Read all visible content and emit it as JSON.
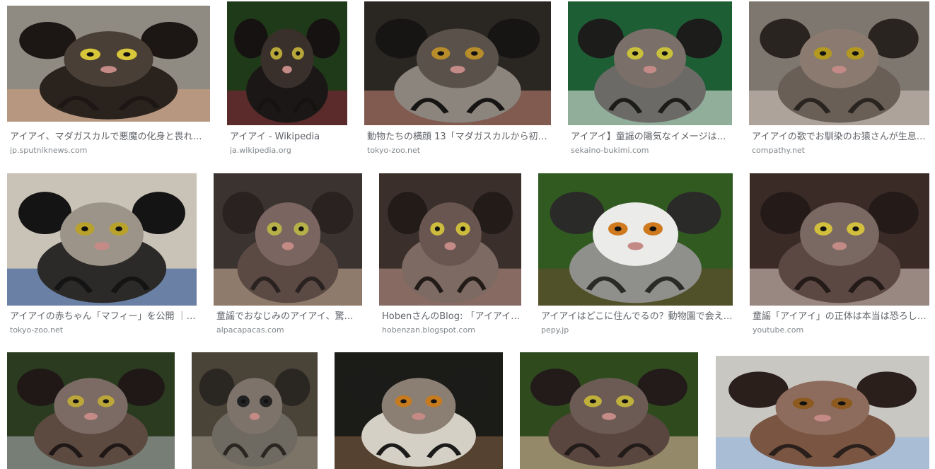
{
  "results": {
    "rows": [
      {
        "items": [
          {
            "title": "アイアイ、マダガスカルで悪魔の化身と畏れら…",
            "source": "jp.sputniknews.com",
            "scene": {
              "bg": "#8f8a82",
              "fur": "#2a231d",
              "face": "#4a3f36",
              "ear": "#1c1714",
              "eye": "#d7c53a",
              "accent": "#d9a37f"
            }
          },
          {
            "title": "アイアイ - Wikipedia",
            "source": "ja.wikipedia.org",
            "scene": {
              "bg": "#1f3a18",
              "fur": "#1a1716",
              "face": "#3a302b",
              "ear": "#151211",
              "eye": "#b7a63a",
              "accent": "#8a1f3b"
            }
          },
          {
            "title": "動物たちの横顔 13「マダガスカルから初来…",
            "source": "tokyo-zoo.net",
            "scene": {
              "bg": "#2a2622",
              "fur": "#8b857d",
              "face": "#5b514b",
              "ear": "#171514",
              "eye": "#b78c2a",
              "accent": "#c88576"
            }
          },
          {
            "title": "アイアイ】童謡の陽気なイメージは間…",
            "source": "sekaino-bukimi.com",
            "scene": {
              "bg": "#1e5e35",
              "fur": "#6c6a66",
              "face": "#7a6f69",
              "ear": "#1c1c1b",
              "eye": "#c9c13c",
              "accent": "#f1f1ef"
            }
          },
          {
            "title": "アイアイの歌でお馴染のお猿さんが生息地…",
            "source": "compathy.net",
            "scene": {
              "bg": "#7d7770",
              "fur": "#6a5f56",
              "face": "#8b7a70",
              "ear": "#2a2420",
              "eye": "#b3991f",
              "accent": "#d7c8bd"
            }
          }
        ]
      },
      {
        "items": [
          {
            "title": "アイアイの赤ちゃん「マフィー」を公開 ｜ …",
            "source": "tokyo-zoo.net",
            "scene": {
              "bg": "#c9c2b6",
              "fur": "#2b2a28",
              "face": "#9c9488",
              "ear": "#141414",
              "eye": "#b9a22b",
              "accent": "#1b4d98"
            }
          },
          {
            "title": "童謡でおなじみのアイアイ、驚愕…",
            "source": "alpacapacas.com",
            "scene": {
              "bg": "#3a3330",
              "fur": "#5b4a44",
              "face": "#7a6560",
              "ear": "#2a2220",
              "eye": "#b7b049",
              "accent": "#d4b79f"
            }
          },
          {
            "title": "HobenさんのBlog: 「アイアイお…",
            "source": "hobenzan.blogspot.com",
            "scene": {
              "bg": "#3b2f2b",
              "fur": "#7d6a62",
              "face": "#6a5651",
              "ear": "#221b18",
              "eye": "#cdbb3e",
              "accent": "#c69d92"
            }
          },
          {
            "title": "アイアイはどこに住んでるの？動物園で会え…",
            "source": "pepy.jp",
            "scene": {
              "bg": "#315a21",
              "fur": "#8f8f8b",
              "face": "#ebebe9",
              "ear": "#2a2a28",
              "eye": "#d07a20",
              "accent": "#6b4a32"
            }
          },
          {
            "title": "童謡「アイアイ」の正体は本当は恐ろしい…",
            "source": "youtube.com",
            "scene": {
              "bg": "#3b2b27",
              "fur": "#5b4842",
              "face": "#7a6963",
              "ear": "#241a18",
              "eye": "#d2bf3d",
              "accent": "#e8d6cc"
            }
          }
        ]
      },
      {
        "items": [
          {
            "title": "",
            "source": "",
            "scene": {
              "bg": "#2a3b1f",
              "fur": "#5c4a41",
              "face": "#7b6b64",
              "ear": "#1f1816",
              "eye": "#bba63a",
              "accent": "#b4b7bb"
            }
          },
          {
            "title": "",
            "source": "",
            "scene": {
              "bg": "#4a4338",
              "fur": "#6e6a61",
              "face": "#7d736a",
              "ear": "#2a2622",
              "eye": "#222222",
              "accent": "#a69d8e"
            }
          },
          {
            "title": "",
            "source": "",
            "scene": {
              "bg": "#1b1b18",
              "fur": "#d5d0c5",
              "face": "#8b7e73",
              "ear": "#1b1b1a",
              "eye": "#c67b1e",
              "accent": "#876345"
            }
          },
          {
            "title": "",
            "source": "",
            "scene": {
              "bg": "#2f4b1e",
              "fur": "#59463f",
              "face": "#6c5b55",
              "ear": "#231b19",
              "eye": "#bfb03c",
              "accent": "#e7c0a7"
            }
          },
          {
            "title": "",
            "source": "",
            "scene": {
              "bg": "#c8c7c2",
              "fur": "#7a5542",
              "face": "#8e6c5d",
              "ear": "#2a1f1a",
              "eye": "#8d5a1f",
              "accent": "#90b5e6"
            }
          }
        ]
      }
    ]
  }
}
